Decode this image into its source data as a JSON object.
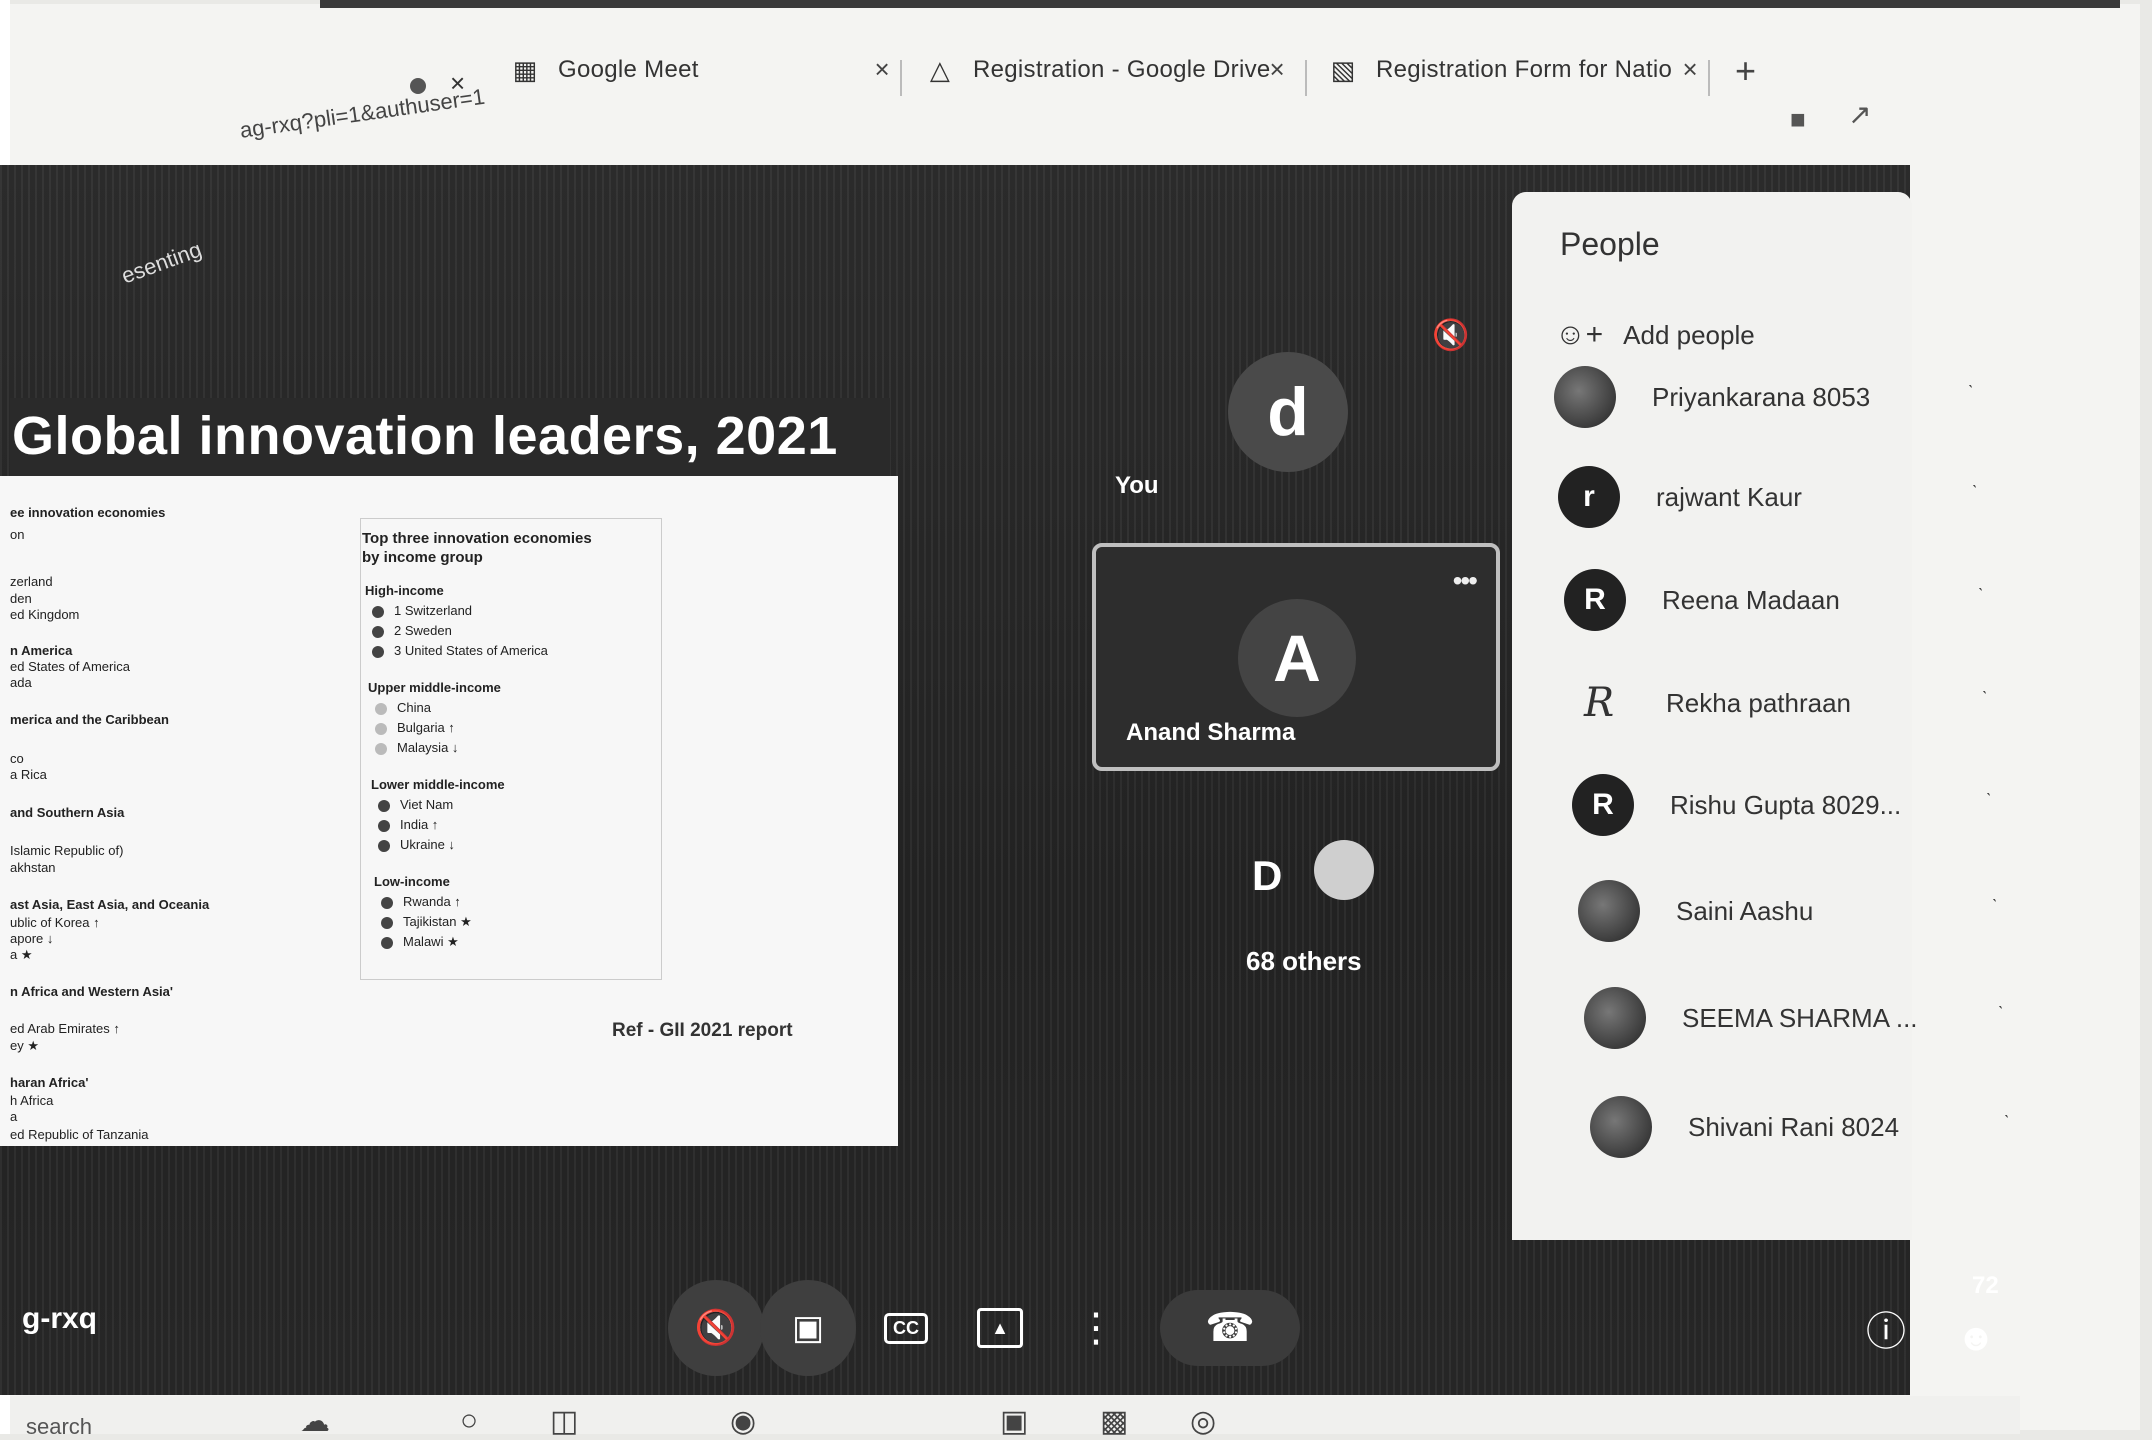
{
  "browser": {
    "tabs": [
      {
        "label": "Google Meet",
        "icon": "meet-icon"
      },
      {
        "label": "Registration - Google Drive",
        "icon": "drive-icon"
      },
      {
        "label": "Registration Form for Natio",
        "icon": "forms-icon"
      }
    ],
    "tab_close_glyph": "×",
    "new_tab_glyph": "+",
    "url_fragment": "ag-rxq?pli=1&authuser=1"
  },
  "stage": {
    "presenting_label": "esenting",
    "slide": {
      "title": "Global innovation leaders, 2021",
      "left_column": [
        {
          "text": "ee innovation economies",
          "bold": true
        },
        {
          "text": "on",
          "bold": false
        },
        {
          "text": "zerland",
          "bold": false
        },
        {
          "text": "den",
          "bold": false
        },
        {
          "text": "ed Kingdom",
          "bold": false
        },
        {
          "text": "n America",
          "bold": true
        },
        {
          "text": "ed States of America",
          "bold": false
        },
        {
          "text": "ada",
          "bold": false
        },
        {
          "text": "merica and the Caribbean",
          "bold": true
        },
        {
          "text": "co",
          "bold": false
        },
        {
          "text": "a Rica",
          "bold": false
        },
        {
          "text": "and Southern Asia",
          "bold": true
        },
        {
          "text": "Islamic Republic of)",
          "bold": false
        },
        {
          "text": "akhstan",
          "bold": false
        },
        {
          "text": "ast Asia, East Asia, and Oceania",
          "bold": true
        },
        {
          "text": "ublic of Korea ↑",
          "bold": false
        },
        {
          "text": "apore ↓",
          "bold": false
        },
        {
          "text": "a ★",
          "bold": false
        },
        {
          "text": "n Africa and Western Asia'",
          "bold": true
        },
        {
          "text": "ed Arab Emirates ↑",
          "bold": false
        },
        {
          "text": "ey ★",
          "bold": false
        },
        {
          "text": "haran Africa'",
          "bold": true
        },
        {
          "text": "h Africa",
          "bold": false
        },
        {
          "text": "a",
          "bold": false
        },
        {
          "text": "ed Republic of Tanzania",
          "bold": false
        }
      ],
      "box_heading": "Top three innovation economies",
      "box_heading2": "by income group",
      "groups": [
        {
          "label": "High-income",
          "items": [
            "1  Switzerland",
            "2  Sweden",
            "3  United States of America"
          ],
          "light": false
        },
        {
          "label": "Upper middle-income",
          "items": [
            "China",
            "Bulgaria ↑",
            "Malaysia ↓"
          ],
          "light": true
        },
        {
          "label": "Lower middle-income",
          "items": [
            "Viet Nam",
            "India ↑",
            "Ukraine ↓"
          ],
          "light": false
        },
        {
          "label": "Low-income",
          "items": [
            "Rwanda ↑",
            "Tajikistan ★",
            "Malawi ★"
          ],
          "light": false
        }
      ],
      "reference": "Ref - GII 2021 report"
    },
    "you": {
      "initial": "d",
      "label": "You"
    },
    "pinned": {
      "initial": "A",
      "name": "Anand Sharma",
      "more_glyph": "•••"
    },
    "others": {
      "initial": "D",
      "label": "68 others"
    }
  },
  "people_panel": {
    "title": "People",
    "add_label": "Add people",
    "people": [
      {
        "name": "Priyankarana 8053",
        "initial": "",
        "avatar": "photo"
      },
      {
        "name": "rajwant Kaur",
        "initial": "r",
        "avatar": "letter"
      },
      {
        "name": "Reena Madaan",
        "initial": "R",
        "avatar": "letter"
      },
      {
        "name": "Rekha pathraan",
        "initial": "R",
        "avatar": "sig"
      },
      {
        "name": "Rishu Gupta 8029...",
        "initial": "R",
        "avatar": "letter"
      },
      {
        "name": "Saini Aashu",
        "initial": "",
        "avatar": "photo"
      },
      {
        "name": "SEEMA SHARMA ...",
        "initial": "",
        "avatar": "photo"
      },
      {
        "name": "Shivani Rani 8024",
        "initial": "",
        "avatar": "photo"
      }
    ]
  },
  "controls": {
    "meeting_code": "g-rxq",
    "captions_label": "CC",
    "people_count": "72"
  },
  "taskbar": {
    "search_label": "search"
  },
  "colors": {
    "stage_bg": "#262626",
    "panel_bg": "#f2f2f0",
    "tile_border": "#bfbfbf"
  }
}
